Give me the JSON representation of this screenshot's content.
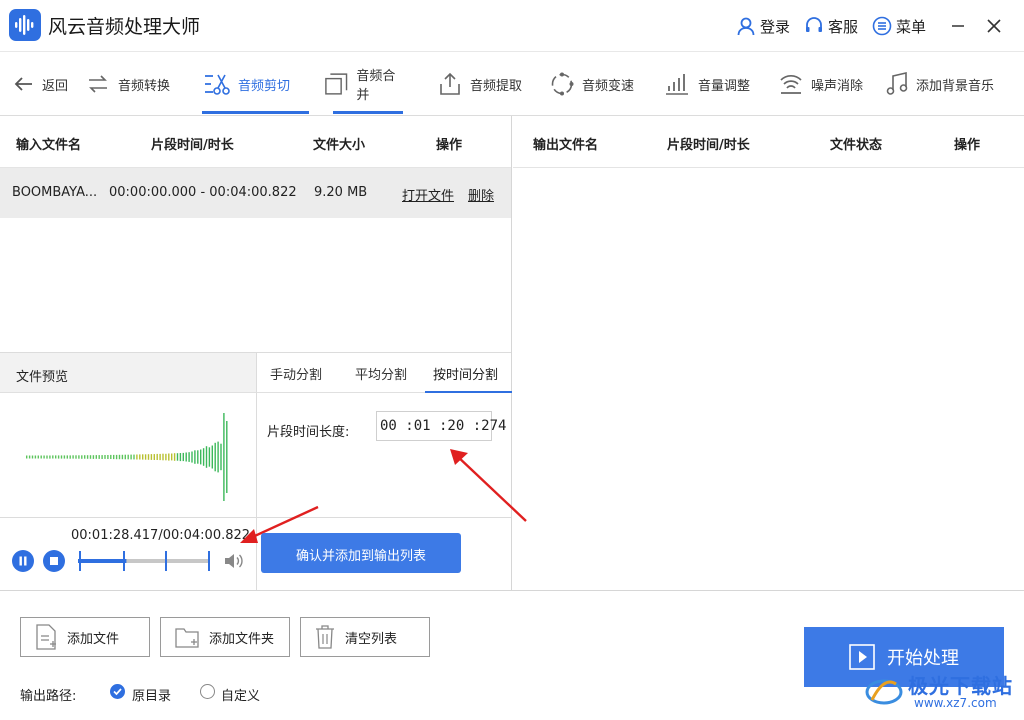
{
  "app": {
    "title": "风云音频处理大师"
  },
  "header": {
    "login": "登录",
    "service": "客服",
    "menu": "菜单"
  },
  "toolbar": {
    "back": "返回",
    "convert": "音频转换",
    "cut": "音频剪切",
    "merge": "音频合并",
    "extract": "音频提取",
    "speed": "音频变速",
    "volume": "音量调整",
    "denoise": "噪声消除",
    "bgm": "添加背景音乐"
  },
  "input_table": {
    "headers": [
      "输入文件名",
      "片段时间/时长",
      "文件大小",
      "操作"
    ],
    "rows": [
      {
        "name": "BOOMBAYA...",
        "range": "00:00:00.000 - 00:04:00.822",
        "size": "9.20 MB",
        "open": "打开文件",
        "delete": "删除"
      }
    ]
  },
  "output_table": {
    "headers": [
      "输出文件名",
      "片段时间/时长",
      "文件状态",
      "操作"
    ]
  },
  "preview": {
    "label": "文件预览",
    "time_readout": "00:01:28.417/00:04:00.822",
    "progress": 0.367
  },
  "split_tabs": {
    "manual": "手动分割",
    "average": "平均分割",
    "by_time": "按时间分割"
  },
  "by_time": {
    "label": "片段时间长度:",
    "value": "00 :01 :20 :274"
  },
  "confirm_button": "确认并添加到输出列表",
  "bottom": {
    "add_file": "添加文件",
    "add_folder": "添加文件夹",
    "clear_list": "清空列表",
    "start": "开始处理",
    "output_path_label": "输出路径:",
    "option_original": "原目录",
    "option_custom": "自定义"
  },
  "watermark": {
    "brand": "极光下载站",
    "site": "www.xz7.com"
  },
  "colors": {
    "accent": "#2f6fe0",
    "button": "#3d7ae6",
    "arrow": "#e02020"
  }
}
